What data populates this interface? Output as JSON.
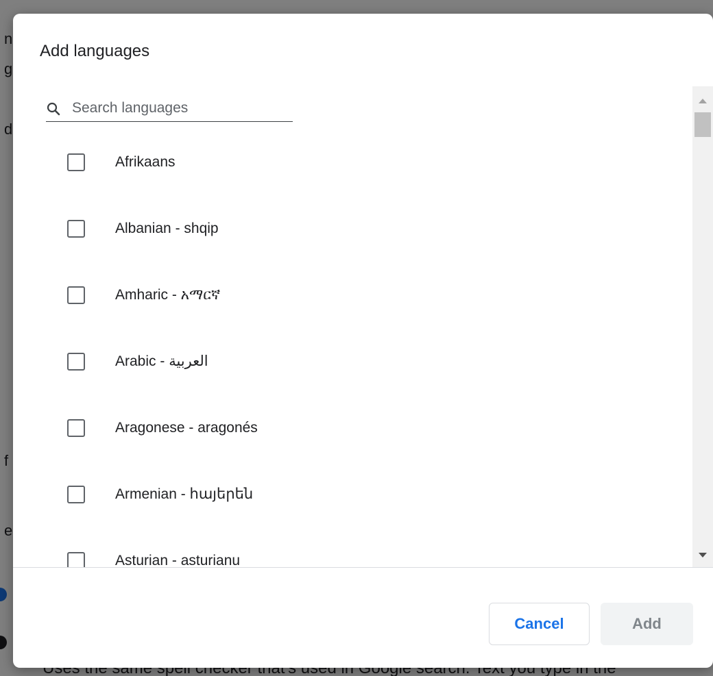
{
  "dialog": {
    "title": "Add languages",
    "search": {
      "placeholder": "Search languages",
      "value": ""
    },
    "languages": [
      {
        "label": "Afrikaans",
        "checked": false
      },
      {
        "label": "Albanian - shqip",
        "checked": false
      },
      {
        "label": "Amharic - አማርኛ",
        "checked": false
      },
      {
        "label": "Arabic - العربية",
        "checked": false
      },
      {
        "label": "Aragonese - aragonés",
        "checked": false
      },
      {
        "label": "Armenian - հայերեն",
        "checked": false
      },
      {
        "label": "Asturian - asturianu",
        "checked": false
      }
    ],
    "buttons": {
      "cancel": "Cancel",
      "add": "Add"
    }
  },
  "background": {
    "fragments": [
      "n",
      "g",
      "d",
      "f",
      "e"
    ],
    "bottom_text": "Uses the same spell checker that's used in Google search. Text you type in the"
  },
  "colors": {
    "accent": "#1a73e8",
    "disabled_button_bg": "#f1f3f4",
    "disabled_button_text": "#80868b",
    "overlay": "#7f7f7f"
  },
  "icons": {
    "search": "search-icon"
  }
}
